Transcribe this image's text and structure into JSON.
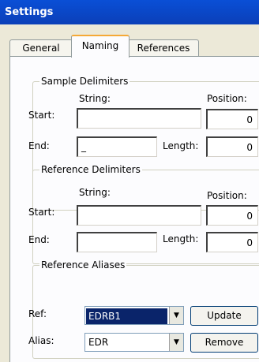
{
  "window": {
    "title": "Settings"
  },
  "tabs": [
    "General",
    "Naming",
    "References"
  ],
  "sample_delimiters": {
    "title": "Sample Delimiters",
    "string_header": "String:",
    "position_header": "Position:",
    "start_label": "Start:",
    "start_value": "",
    "start_position": "0",
    "end_label": "End:",
    "end_value": "_",
    "length_label": "Length:",
    "length_value": "0"
  },
  "reference_delimiters": {
    "title": "Reference Delimiters",
    "string_header": "String:",
    "position_header": "Position:",
    "start_label": "Start:",
    "start_value": "",
    "start_position": "0",
    "end_label": "End:",
    "end_value": "",
    "length_label": "Length:",
    "length_value": "0"
  },
  "reference_aliases": {
    "title": "Reference Aliases",
    "ref_label": "Ref:",
    "ref_value": "EDRB1",
    "alias_label": "Alias:",
    "alias_value": "EDR",
    "update_label": "Update",
    "remove_label": "Remove"
  },
  "icons": {
    "combo_arrow": "▼"
  }
}
